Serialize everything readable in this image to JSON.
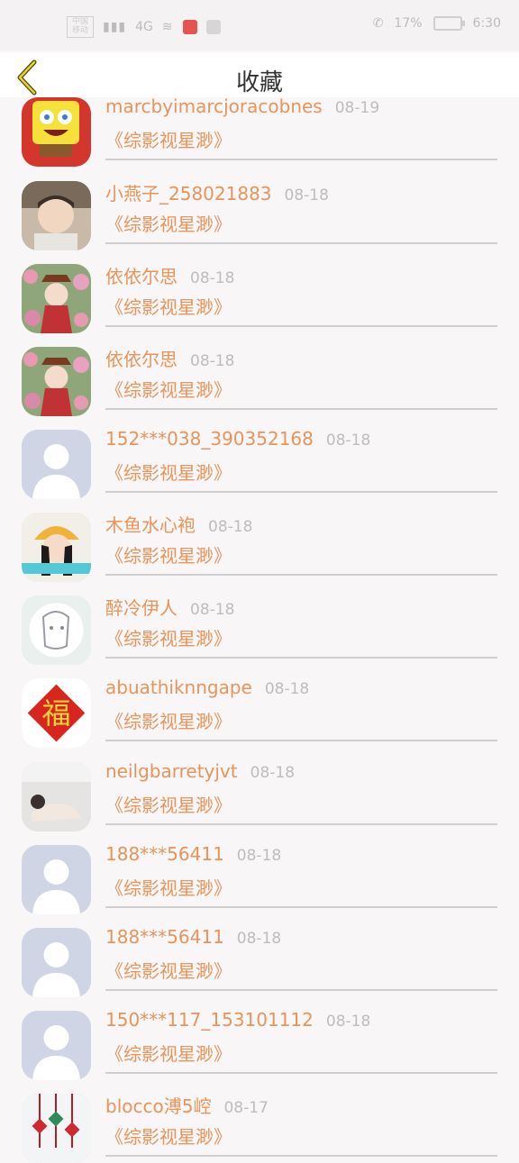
{
  "status_bar": {
    "carrier": "中国\n移动",
    "signal": "4G",
    "battery": "17%",
    "time": "6:30"
  },
  "header": {
    "title": "收藏"
  },
  "colors": {
    "accent": "#e8945a",
    "date": "#bdbdbd",
    "divider": "#cfcfcf"
  },
  "items": [
    {
      "name": "marcbyimarcjoracobnes",
      "date": "08-19",
      "book": "《综影视星渺》",
      "avatar": "cartoon-sponge-avatar"
    },
    {
      "name": "小燕子_258021883",
      "date": "08-18",
      "book": "《综影视星渺》",
      "avatar": "boy-photo-avatar"
    },
    {
      "name": "依依尔思",
      "date": "08-18",
      "book": "《综影视星渺》",
      "avatar": "anime-girl-flowers-avatar"
    },
    {
      "name": "依依尔思",
      "date": "08-18",
      "book": "《综影视星渺》",
      "avatar": "anime-girl-flowers-avatar"
    },
    {
      "name": "152***038_390352168",
      "date": "08-18",
      "book": "《综影视星渺》",
      "avatar": "default-user-avatar"
    },
    {
      "name": "木鱼水心袍",
      "date": "08-18",
      "book": "《综影视星渺》",
      "avatar": "girl-yellow-hat-avatar"
    },
    {
      "name": "醉冷伊人",
      "date": "08-18",
      "book": "《综影视星渺》",
      "avatar": "sketch-girl-avatar"
    },
    {
      "name": "abuathiknngape",
      "date": "08-18",
      "book": "《综影视星渺》",
      "avatar": "fu-character-avatar"
    },
    {
      "name": "neilgbarretyjvt",
      "date": "08-18",
      "book": "《综影视星渺》",
      "avatar": "girl-lying-avatar"
    },
    {
      "name": "188***56411",
      "date": "08-18",
      "book": "《综影视星渺》",
      "avatar": "default-user-avatar"
    },
    {
      "name": "188***56411",
      "date": "08-18",
      "book": "《综影视星渺》",
      "avatar": "default-user-avatar"
    },
    {
      "name": "150***117_153101112",
      "date": "08-18",
      "book": "《综影视星渺》",
      "avatar": "default-user-avatar"
    },
    {
      "name": "blocco溥5崆",
      "date": "08-17",
      "book": "《综影视星渺》",
      "avatar": "chinese-knots-avatar"
    }
  ]
}
